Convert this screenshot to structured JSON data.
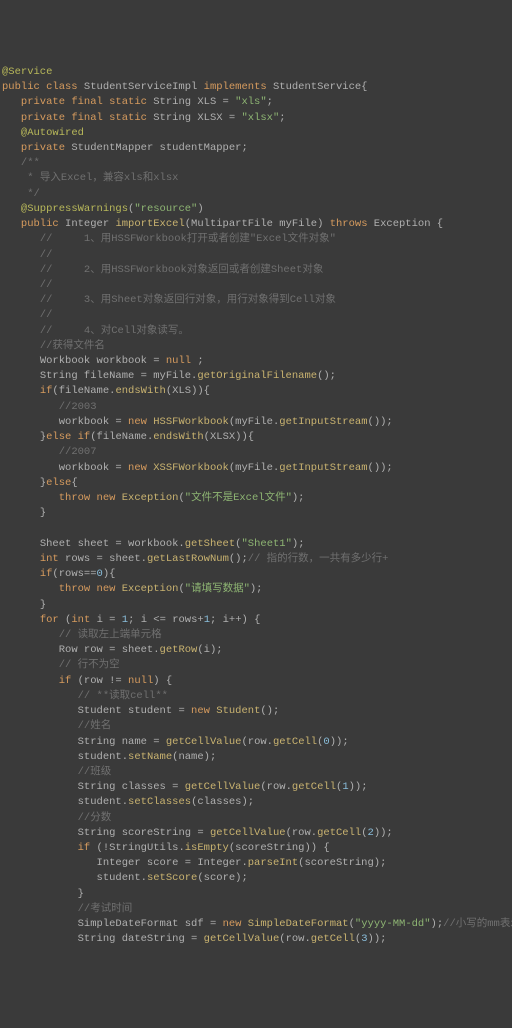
{
  "lines": [
    {
      "segs": [
        {
          "c": "ann",
          "t": "@Service"
        }
      ]
    },
    {
      "segs": [
        {
          "c": "kw",
          "t": "public class "
        },
        {
          "c": "id",
          "t": "StudentServiceImpl "
        },
        {
          "c": "kw",
          "t": "implements "
        },
        {
          "c": "id",
          "t": "StudentService{"
        }
      ]
    },
    {
      "segs": [
        {
          "c": "",
          "t": "   "
        },
        {
          "c": "kw",
          "t": "private final static "
        },
        {
          "c": "id",
          "t": "String XLS = "
        },
        {
          "c": "str",
          "t": "\"xls\""
        },
        {
          "c": "id",
          "t": ";"
        }
      ]
    },
    {
      "segs": [
        {
          "c": "",
          "t": "   "
        },
        {
          "c": "kw",
          "t": "private final static "
        },
        {
          "c": "id",
          "t": "String XLSX = "
        },
        {
          "c": "str",
          "t": "\"xlsx\""
        },
        {
          "c": "id",
          "t": ";"
        }
      ]
    },
    {
      "segs": [
        {
          "c": "",
          "t": "   "
        },
        {
          "c": "ann",
          "t": "@Autowired"
        }
      ]
    },
    {
      "segs": [
        {
          "c": "",
          "t": "   "
        },
        {
          "c": "kw",
          "t": "private "
        },
        {
          "c": "id",
          "t": "StudentMapper studentMapper;"
        }
      ]
    },
    {
      "segs": [
        {
          "c": "",
          "t": "   "
        },
        {
          "c": "cmt",
          "t": "/**"
        }
      ]
    },
    {
      "segs": [
        {
          "c": "",
          "t": "    "
        },
        {
          "c": "cmt",
          "t": "* 导入Excel，兼容xls和xlsx"
        }
      ]
    },
    {
      "segs": [
        {
          "c": "",
          "t": "    "
        },
        {
          "c": "cmt",
          "t": "*/"
        }
      ]
    },
    {
      "segs": [
        {
          "c": "",
          "t": "   "
        },
        {
          "c": "ann",
          "t": "@SuppressWarnings"
        },
        {
          "c": "id",
          "t": "("
        },
        {
          "c": "str",
          "t": "\"resource\""
        },
        {
          "c": "id",
          "t": ")"
        }
      ]
    },
    {
      "segs": [
        {
          "c": "",
          "t": "   "
        },
        {
          "c": "kw",
          "t": "public "
        },
        {
          "c": "id",
          "t": "Integer "
        },
        {
          "c": "fn",
          "t": "importExcel"
        },
        {
          "c": "id",
          "t": "(MultipartFile myFile) "
        },
        {
          "c": "kw",
          "t": "throws "
        },
        {
          "c": "id",
          "t": "Exception {"
        }
      ]
    },
    {
      "segs": [
        {
          "c": "",
          "t": "      "
        },
        {
          "c": "cmt",
          "t": "//     1、用HSSFWorkbook打开或者创建\"Excel文件对象\""
        }
      ]
    },
    {
      "segs": [
        {
          "c": "cmt",
          "t": "      //"
        }
      ]
    },
    {
      "segs": [
        {
          "c": "",
          "t": "      "
        },
        {
          "c": "cmt",
          "t": "//     2、用HSSFWorkbook对象返回或者创建Sheet对象"
        }
      ]
    },
    {
      "segs": [
        {
          "c": "cmt",
          "t": "      //"
        }
      ]
    },
    {
      "segs": [
        {
          "c": "",
          "t": "      "
        },
        {
          "c": "cmt",
          "t": "//     3、用Sheet对象返回行对象，用行对象得到Cell对象"
        }
      ]
    },
    {
      "segs": [
        {
          "c": "cmt",
          "t": "      //"
        }
      ]
    },
    {
      "segs": [
        {
          "c": "",
          "t": "      "
        },
        {
          "c": "cmt",
          "t": "//     4、对Cell对象读写。"
        }
      ]
    },
    {
      "segs": [
        {
          "c": "",
          "t": "      "
        },
        {
          "c": "cmt",
          "t": "//获得文件名"
        }
      ]
    },
    {
      "segs": [
        {
          "c": "",
          "t": "      "
        },
        {
          "c": "id",
          "t": "Workbook workbook = "
        },
        {
          "c": "kw",
          "t": "null"
        },
        {
          "c": "id",
          "t": " ;"
        }
      ]
    },
    {
      "segs": [
        {
          "c": "",
          "t": "      "
        },
        {
          "c": "id",
          "t": "String fileName = myFile."
        },
        {
          "c": "fn",
          "t": "getOriginalFilename"
        },
        {
          "c": "id",
          "t": "();"
        }
      ]
    },
    {
      "segs": [
        {
          "c": "",
          "t": "      "
        },
        {
          "c": "kw",
          "t": "if"
        },
        {
          "c": "id",
          "t": "(fileName."
        },
        {
          "c": "fn",
          "t": "endsWith"
        },
        {
          "c": "id",
          "t": "(XLS)){"
        }
      ]
    },
    {
      "segs": [
        {
          "c": "",
          "t": "         "
        },
        {
          "c": "cmt",
          "t": "//2003"
        }
      ]
    },
    {
      "segs": [
        {
          "c": "",
          "t": "         "
        },
        {
          "c": "id",
          "t": "workbook = "
        },
        {
          "c": "kw",
          "t": "new "
        },
        {
          "c": "fn",
          "t": "HSSFWorkbook"
        },
        {
          "c": "id",
          "t": "(myFile."
        },
        {
          "c": "fn",
          "t": "getInputStream"
        },
        {
          "c": "id",
          "t": "());"
        }
      ]
    },
    {
      "segs": [
        {
          "c": "",
          "t": "      "
        },
        {
          "c": "id",
          "t": "}"
        },
        {
          "c": "kw",
          "t": "else if"
        },
        {
          "c": "id",
          "t": "(fileName."
        },
        {
          "c": "fn",
          "t": "endsWith"
        },
        {
          "c": "id",
          "t": "(XLSX)){"
        }
      ]
    },
    {
      "segs": [
        {
          "c": "",
          "t": "         "
        },
        {
          "c": "cmt",
          "t": "//2007"
        }
      ]
    },
    {
      "segs": [
        {
          "c": "",
          "t": "         "
        },
        {
          "c": "id",
          "t": "workbook = "
        },
        {
          "c": "kw",
          "t": "new "
        },
        {
          "c": "fn",
          "t": "XSSFWorkbook"
        },
        {
          "c": "id",
          "t": "(myFile."
        },
        {
          "c": "fn",
          "t": "getInputStream"
        },
        {
          "c": "id",
          "t": "());"
        }
      ]
    },
    {
      "segs": [
        {
          "c": "",
          "t": "      "
        },
        {
          "c": "id",
          "t": "}"
        },
        {
          "c": "kw",
          "t": "else"
        },
        {
          "c": "id",
          "t": "{"
        }
      ]
    },
    {
      "segs": [
        {
          "c": "",
          "t": "         "
        },
        {
          "c": "kw",
          "t": "throw new "
        },
        {
          "c": "fn",
          "t": "Exception"
        },
        {
          "c": "id",
          "t": "("
        },
        {
          "c": "str",
          "t": "\"文件不是Excel文件\""
        },
        {
          "c": "id",
          "t": ");"
        }
      ]
    },
    {
      "segs": [
        {
          "c": "",
          "t": "      "
        },
        {
          "c": "id",
          "t": "}"
        }
      ]
    },
    {
      "segs": [
        {
          "c": "",
          "t": " "
        }
      ]
    },
    {
      "segs": [
        {
          "c": "",
          "t": "      "
        },
        {
          "c": "id",
          "t": "Sheet sheet = workbook."
        },
        {
          "c": "fn",
          "t": "getSheet"
        },
        {
          "c": "id",
          "t": "("
        },
        {
          "c": "str",
          "t": "\"Sheet1\""
        },
        {
          "c": "id",
          "t": ");"
        }
      ]
    },
    {
      "segs": [
        {
          "c": "",
          "t": "      "
        },
        {
          "c": "kw",
          "t": "int "
        },
        {
          "c": "id",
          "t": "rows = sheet."
        },
        {
          "c": "fn",
          "t": "getLastRowNum"
        },
        {
          "c": "id",
          "t": "();"
        },
        {
          "c": "cmt",
          "t": "// 指的行数，一共有多少行+"
        }
      ]
    },
    {
      "segs": [
        {
          "c": "",
          "t": "      "
        },
        {
          "c": "kw",
          "t": "if"
        },
        {
          "c": "id",
          "t": "(rows=="
        },
        {
          "c": "num",
          "t": "0"
        },
        {
          "c": "id",
          "t": "){"
        }
      ]
    },
    {
      "segs": [
        {
          "c": "",
          "t": "         "
        },
        {
          "c": "kw",
          "t": "throw new "
        },
        {
          "c": "fn",
          "t": "Exception"
        },
        {
          "c": "id",
          "t": "("
        },
        {
          "c": "str",
          "t": "\"请填写数据\""
        },
        {
          "c": "id",
          "t": ");"
        }
      ]
    },
    {
      "segs": [
        {
          "c": "",
          "t": "      "
        },
        {
          "c": "id",
          "t": "}"
        }
      ]
    },
    {
      "segs": [
        {
          "c": "",
          "t": "      "
        },
        {
          "c": "kw",
          "t": "for "
        },
        {
          "c": "id",
          "t": "("
        },
        {
          "c": "kw",
          "t": "int "
        },
        {
          "c": "id",
          "t": "i = "
        },
        {
          "c": "num",
          "t": "1"
        },
        {
          "c": "id",
          "t": "; i <= rows+"
        },
        {
          "c": "num",
          "t": "1"
        },
        {
          "c": "id",
          "t": "; i++) {"
        }
      ]
    },
    {
      "segs": [
        {
          "c": "",
          "t": "         "
        },
        {
          "c": "cmt",
          "t": "// 读取左上端单元格"
        }
      ]
    },
    {
      "segs": [
        {
          "c": "",
          "t": "         "
        },
        {
          "c": "id",
          "t": "Row row = sheet."
        },
        {
          "c": "fn",
          "t": "getRow"
        },
        {
          "c": "id",
          "t": "(i);"
        }
      ]
    },
    {
      "segs": [
        {
          "c": "",
          "t": "         "
        },
        {
          "c": "cmt",
          "t": "// 行不为空"
        }
      ]
    },
    {
      "segs": [
        {
          "c": "",
          "t": "         "
        },
        {
          "c": "kw",
          "t": "if "
        },
        {
          "c": "id",
          "t": "(row != "
        },
        {
          "c": "kw",
          "t": "null"
        },
        {
          "c": "id",
          "t": ") {"
        }
      ]
    },
    {
      "segs": [
        {
          "c": "",
          "t": "            "
        },
        {
          "c": "cmt",
          "t": "// **读取cell**"
        }
      ]
    },
    {
      "segs": [
        {
          "c": "",
          "t": "            "
        },
        {
          "c": "id",
          "t": "Student student = "
        },
        {
          "c": "kw",
          "t": "new "
        },
        {
          "c": "fn",
          "t": "Student"
        },
        {
          "c": "id",
          "t": "();"
        }
      ]
    },
    {
      "segs": [
        {
          "c": "",
          "t": "            "
        },
        {
          "c": "cmt",
          "t": "//姓名"
        }
      ]
    },
    {
      "segs": [
        {
          "c": "",
          "t": "            "
        },
        {
          "c": "id",
          "t": "String name = "
        },
        {
          "c": "fn",
          "t": "getCellValue"
        },
        {
          "c": "id",
          "t": "(row."
        },
        {
          "c": "fn",
          "t": "getCell"
        },
        {
          "c": "id",
          "t": "("
        },
        {
          "c": "num",
          "t": "0"
        },
        {
          "c": "id",
          "t": "));"
        }
      ]
    },
    {
      "segs": [
        {
          "c": "",
          "t": "            "
        },
        {
          "c": "id",
          "t": "student."
        },
        {
          "c": "fn",
          "t": "setName"
        },
        {
          "c": "id",
          "t": "(name);"
        }
      ]
    },
    {
      "segs": [
        {
          "c": "",
          "t": "            "
        },
        {
          "c": "cmt",
          "t": "//班级"
        }
      ]
    },
    {
      "segs": [
        {
          "c": "",
          "t": "            "
        },
        {
          "c": "id",
          "t": "String classes = "
        },
        {
          "c": "fn",
          "t": "getCellValue"
        },
        {
          "c": "id",
          "t": "(row."
        },
        {
          "c": "fn",
          "t": "getCell"
        },
        {
          "c": "id",
          "t": "("
        },
        {
          "c": "num",
          "t": "1"
        },
        {
          "c": "id",
          "t": "));"
        }
      ]
    },
    {
      "segs": [
        {
          "c": "",
          "t": "            "
        },
        {
          "c": "id",
          "t": "student."
        },
        {
          "c": "fn",
          "t": "setClasses"
        },
        {
          "c": "id",
          "t": "(classes);"
        }
      ]
    },
    {
      "segs": [
        {
          "c": "",
          "t": "            "
        },
        {
          "c": "cmt",
          "t": "//分数"
        }
      ]
    },
    {
      "segs": [
        {
          "c": "",
          "t": "            "
        },
        {
          "c": "id",
          "t": "String scoreString = "
        },
        {
          "c": "fn",
          "t": "getCellValue"
        },
        {
          "c": "id",
          "t": "(row."
        },
        {
          "c": "fn",
          "t": "getCell"
        },
        {
          "c": "id",
          "t": "("
        },
        {
          "c": "num",
          "t": "2"
        },
        {
          "c": "id",
          "t": "));"
        }
      ]
    },
    {
      "segs": [
        {
          "c": "",
          "t": "            "
        },
        {
          "c": "kw",
          "t": "if "
        },
        {
          "c": "id",
          "t": "(!StringUtils."
        },
        {
          "c": "fn",
          "t": "isEmpty"
        },
        {
          "c": "id",
          "t": "(scoreString)) {"
        }
      ]
    },
    {
      "segs": [
        {
          "c": "",
          "t": "               "
        },
        {
          "c": "id",
          "t": "Integer score = Integer."
        },
        {
          "c": "fn",
          "t": "parseInt"
        },
        {
          "c": "id",
          "t": "(scoreString);"
        }
      ]
    },
    {
      "segs": [
        {
          "c": "",
          "t": "               "
        },
        {
          "c": "id",
          "t": "student."
        },
        {
          "c": "fn",
          "t": "setScore"
        },
        {
          "c": "id",
          "t": "(score);"
        }
      ]
    },
    {
      "segs": [
        {
          "c": "",
          "t": "            "
        },
        {
          "c": "id",
          "t": "}"
        }
      ]
    },
    {
      "segs": [
        {
          "c": "",
          "t": "            "
        },
        {
          "c": "cmt",
          "t": "//考试时间"
        }
      ]
    },
    {
      "segs": [
        {
          "c": "",
          "t": "            "
        },
        {
          "c": "id",
          "t": "SimpleDateFormat sdf = "
        },
        {
          "c": "kw",
          "t": "new "
        },
        {
          "c": "fn",
          "t": "SimpleDateFormat"
        },
        {
          "c": "id",
          "t": "("
        },
        {
          "c": "str",
          "t": "\"yyyy-MM-dd\""
        },
        {
          "c": "id",
          "t": ");"
        },
        {
          "c": "cmt",
          "t": "//小写的mm表示的是分钟"
        }
      ]
    },
    {
      "segs": [
        {
          "c": "",
          "t": "            "
        },
        {
          "c": "id",
          "t": "String dateString = "
        },
        {
          "c": "fn",
          "t": "getCellValue"
        },
        {
          "c": "id",
          "t": "(row."
        },
        {
          "c": "fn",
          "t": "getCell"
        },
        {
          "c": "id",
          "t": "("
        },
        {
          "c": "num",
          "t": "3"
        },
        {
          "c": "id",
          "t": "));"
        }
      ]
    }
  ]
}
